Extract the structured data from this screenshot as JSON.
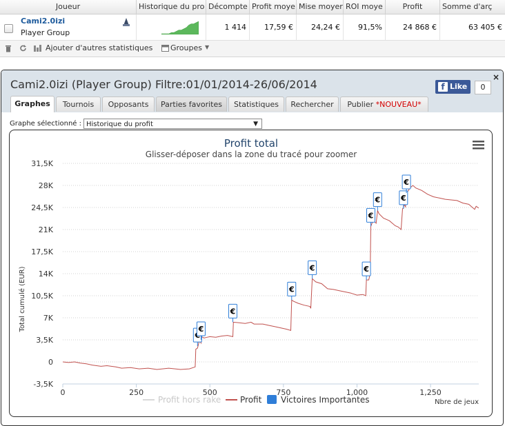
{
  "table": {
    "headers": [
      "Joueur",
      "Historique du pro",
      "Décompte",
      "Profit moye",
      "Mise moyer",
      "ROI moye",
      "Profit",
      "Somme d'arç"
    ],
    "player_name": "Cami2.0izi",
    "player_group": "Player Group",
    "sparkline": [
      0,
      0,
      0,
      0,
      1,
      1,
      2,
      3,
      3,
      4,
      5,
      7,
      8,
      8,
      9,
      10
    ],
    "cells": [
      "1 414",
      "17,59 €",
      "24,24 €",
      "91,5%",
      "24 868 €",
      "63 405 €"
    ],
    "toolbar": {
      "add_stats": "Ajouter d'autres statistiques",
      "groups": "Groupes"
    }
  },
  "panel": {
    "title": "Cami2.0izi (Player Group) Filtre:01/01/2014-26/06/2014",
    "like_label": "Like",
    "like_count": "0",
    "close_symbol": "×",
    "tabs": [
      "Graphes",
      "Tournois",
      "Opposants",
      "Parties favorites",
      "Statistiques",
      "Rechercher",
      "Publier "
    ],
    "tab_new_badge": "*NOUVEAU*",
    "graph_select_label": "Graphe sélectionné :",
    "graph_select_value": "Historique du profit"
  },
  "colors": {
    "profit_line": "#c0504d",
    "profit_hors_rake": "#d8d8d8",
    "big_wins": "#2f7ed8",
    "fb_blue": "#3b5998"
  },
  "icons": [
    "trash-icon",
    "refresh-icon",
    "groups-icon",
    "menu-icon",
    "euro-flag-icon",
    "facebook-icon",
    "close-icon"
  ],
  "chart_data": {
    "type": "line",
    "title": "Profit total",
    "subtitle": "Glisser-déposer dans la zone du tracé pour zoomer",
    "ylabel": "Total cumulé (EUR)",
    "xlabel": "Nbre de jeux",
    "ylim": [
      -3500,
      31500
    ],
    "xlim": [
      0,
      1414
    ],
    "yticks": [
      -3500,
      0,
      3500,
      7000,
      10500,
      14000,
      17500,
      21000,
      24500,
      28000,
      31500
    ],
    "yticklabels": [
      "-3,5K",
      "0",
      "3,5K",
      "7K",
      "10,5K",
      "14K",
      "17,5K",
      "21K",
      "24,5K",
      "28K",
      "31,5K"
    ],
    "xticks": [
      0,
      250,
      500,
      750,
      1000,
      1250
    ],
    "xticklabels": [
      "0",
      "250",
      "500",
      "750",
      "1,000",
      "1,250"
    ],
    "grid": true,
    "legend_position": "bottom",
    "legend": [
      "Profit hors rake",
      "Profit",
      "Victoires Importantes"
    ],
    "flag_symbol": "€",
    "series": [
      {
        "name": "Profit",
        "x": [
          0,
          20,
          40,
          60,
          80,
          100,
          130,
          150,
          180,
          200,
          230,
          260,
          290,
          320,
          360,
          400,
          430,
          450,
          452,
          458,
          465,
          470,
          472,
          480,
          490,
          500,
          520,
          540,
          560,
          578,
          580,
          600,
          620,
          640,
          650,
          680,
          700,
          720,
          740,
          760,
          775,
          778,
          785,
          800,
          820,
          840,
          843,
          848,
          860,
          880,
          900,
          920,
          940,
          960,
          980,
          1000,
          1020,
          1030,
          1032,
          1040,
          1045,
          1047,
          1055,
          1065,
          1070,
          1075,
          1090,
          1110,
          1130,
          1140,
          1150,
          1155,
          1158,
          1160,
          1165,
          1168,
          1175,
          1180,
          1190,
          1200,
          1220,
          1240,
          1260,
          1280,
          1300,
          1320,
          1340,
          1360,
          1380,
          1400,
          1405,
          1414
        ],
        "y": [
          0,
          -100,
          0,
          -200,
          -300,
          -500,
          -700,
          -600,
          -800,
          -1000,
          -900,
          -1100,
          -1000,
          -1200,
          -1000,
          -1200,
          -1100,
          -800,
          2000,
          2200,
          3500,
          3000,
          4000,
          3800,
          3900,
          4000,
          3900,
          4100,
          4200,
          4000,
          6300,
          6200,
          6100,
          6300,
          6000,
          6000,
          5800,
          5600,
          5400,
          5200,
          5000,
          9800,
          9600,
          9300,
          9000,
          8800,
          8500,
          13200,
          12700,
          12400,
          11600,
          11500,
          11300,
          11100,
          10900,
          10600,
          10700,
          10500,
          13000,
          13000,
          14000,
          21500,
          22500,
          22000,
          24000,
          23500,
          22800,
          22400,
          21600,
          21400,
          21000,
          24300,
          24400,
          25000,
          24600,
          26800,
          27200,
          27600,
          28000,
          27600,
          27200,
          26600,
          26200,
          26000,
          25800,
          25700,
          25600,
          25200,
          25000,
          24200,
          24700,
          24400
        ]
      }
    ],
    "big_wins": [
      {
        "x": 458,
        "y": 2500
      },
      {
        "x": 470,
        "y": 3500
      },
      {
        "x": 578,
        "y": 6300
      },
      {
        "x": 778,
        "y": 9800
      },
      {
        "x": 848,
        "y": 13200
      },
      {
        "x": 1032,
        "y": 13000
      },
      {
        "x": 1047,
        "y": 21500
      },
      {
        "x": 1070,
        "y": 24000
      },
      {
        "x": 1158,
        "y": 24300
      },
      {
        "x": 1168,
        "y": 26800
      }
    ]
  }
}
